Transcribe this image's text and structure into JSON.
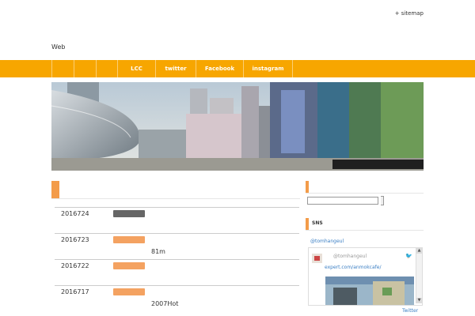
{
  "header": {
    "sitemap": "+ sitemap",
    "site_title": "Web"
  },
  "nav": {
    "items": [
      "",
      "",
      "",
      "LCC",
      "twitter",
      "Facebook",
      "instagram"
    ]
  },
  "news": [
    {
      "date": "2016724",
      "tag_color": "#666666",
      "text": ""
    },
    {
      "date": "2016723",
      "tag_color": "#f4a261",
      "text": "81m"
    },
    {
      "date": "2016722",
      "tag_color": "#f4a261",
      "text": ""
    },
    {
      "date": "2016717",
      "tag_color": "#f4a261",
      "text": "2007Hot"
    }
  ],
  "sidebar": {
    "sns_title": "SNS",
    "twitter_handle": "@tomhangeul",
    "tweet_user": "@tomhangeul",
    "tweet_link": "expert.com/anmokcafe/",
    "twitter_footer": "Twitter"
  },
  "colors": {
    "accent": "#f7a600",
    "tag_orange": "#f4a261"
  }
}
